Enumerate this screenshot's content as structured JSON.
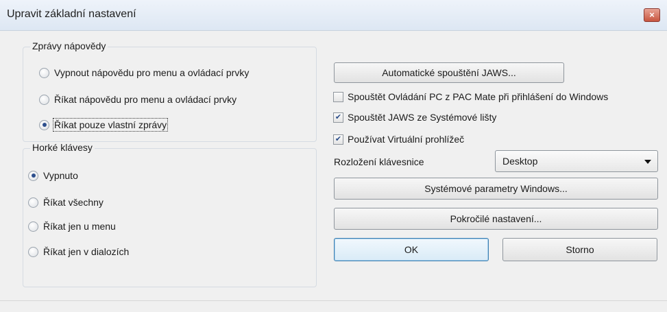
{
  "window": {
    "title": "Upravit základní nastavení",
    "close_glyph": "×"
  },
  "help_group": {
    "legend": "Zprávy nápovědy",
    "options": [
      {
        "label": "Vypnout nápovědu pro menu a ovládací prvky",
        "selected": false
      },
      {
        "label": "Říkat nápovědu pro menu a ovládací prvky",
        "selected": false
      },
      {
        "label": "Říkat pouze vlastní zprávy",
        "selected": true
      }
    ]
  },
  "hotkeys_group": {
    "legend": "Horké klávesy",
    "options": [
      {
        "label": "Vypnuto",
        "selected": true
      },
      {
        "label": "Říkat všechny",
        "selected": false
      },
      {
        "label": "Říkat jen u menu",
        "selected": false
      },
      {
        "label": "Říkat jen v dialozích",
        "selected": false
      }
    ]
  },
  "buttons": {
    "auto_start": "Automatické spouštění JAWS...",
    "system_params": "Systémové parametry Windows...",
    "advanced": "Pokročilé nastavení...",
    "ok": "OK",
    "cancel": "Storno"
  },
  "checkboxes": [
    {
      "label": "Spouštět Ovládání PC z PAC Mate při přihlášení do Windows",
      "checked": false
    },
    {
      "label": "Spouštět JAWS ze Systémové lišty",
      "checked": true
    },
    {
      "label": "Používat Virtuální prohlížeč",
      "checked": true
    }
  ],
  "keyboard_layout": {
    "label": "Rozložení klávesnice",
    "value": "Desktop"
  },
  "icons": {
    "checkmark": "✔"
  }
}
